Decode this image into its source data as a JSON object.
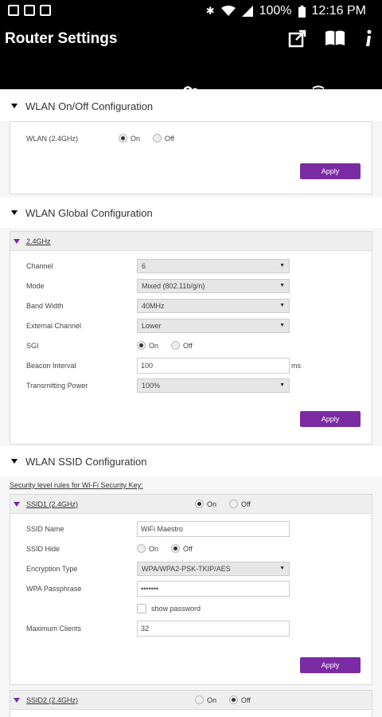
{
  "statusbar": {
    "battery": "100%",
    "time": "12:16 PM"
  },
  "appbar": {
    "title": "Router Settings"
  },
  "tabs": [
    {
      "name": "speedometer"
    },
    {
      "name": "users"
    },
    {
      "name": "router"
    }
  ],
  "wlan_onoff": {
    "title": "WLAN On/Off Configuration",
    "label": "WLAN (2.4GHz)",
    "on": "On",
    "off": "Off",
    "selected": "On",
    "apply": "Apply"
  },
  "wlan_global": {
    "title": "WLAN Global Configuration",
    "band": "2.4GHz",
    "fields": {
      "channel": {
        "label": "Channel",
        "value": "6"
      },
      "mode": {
        "label": "Mode",
        "value": "Mixed (802.11b/g/n)"
      },
      "bandwidth": {
        "label": "Band Width",
        "value": "40MHz"
      },
      "ext_channel": {
        "label": "External Channel",
        "value": "Lower"
      },
      "sgi": {
        "label": "SGI",
        "on": "On",
        "off": "Off"
      },
      "beacon": {
        "label": "Beacon Interval",
        "value": "100",
        "unit": "ms"
      },
      "tx_power": {
        "label": "Transmitting Power",
        "value": "100%"
      }
    },
    "apply": "Apply"
  },
  "wlan_ssid": {
    "title": "WLAN SSID Configuration",
    "security_link": "Security level rules for Wi-Fi Security Key:",
    "ssid1": {
      "header": "SSID1 (2.4GHz)",
      "on": "On",
      "off": "Off",
      "name_label": "SSID Name",
      "name_value": "WiFi Maestro",
      "hide_label": "SSID Hide",
      "hide_on": "On",
      "hide_off": "Off",
      "enc_label": "Encryption Type",
      "enc_value": "WPA/WPA2-PSK-TKIP/AES",
      "pass_label": "WPA Passphrase",
      "pass_value": "•••••••",
      "show_pass": "show password",
      "max_label": "Maximum Clients",
      "max_value": "32",
      "apply": "Apply"
    },
    "ssid2": {
      "header": "SSID2 (2.4GHz)",
      "on": "On",
      "off": "Off"
    }
  }
}
